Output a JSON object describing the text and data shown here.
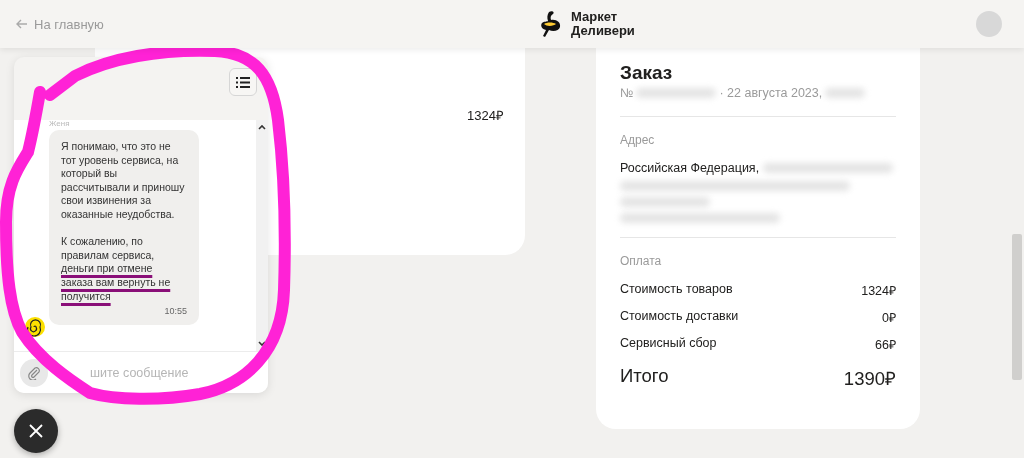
{
  "header": {
    "back_link": "На главную",
    "logo": {
      "line_1": "Маркет",
      "line_2": "Деливери"
    }
  },
  "items_card": {
    "price": "1324₽"
  },
  "chat": {
    "sender": "Женя",
    "messages": [
      {
        "paragraphs": [
          [
            {
              "text": "Я понимаю, что это не тот уровень сервиса, на который вы рассчитывали и приношу свои извинения за оказанные неудобства.",
              "underlined": false
            }
          ],
          [
            {
              "text": "К сожалению, по правилам сервиса, ",
              "underlined": false
            },
            {
              "text": "деньги при отмене заказа вам вернуть не получится",
              "underlined": true
            }
          ]
        ],
        "time": "10:55"
      }
    ],
    "input": {
      "placeholder": "шите сообщение"
    }
  },
  "order": {
    "title": "Заказ",
    "number_prefix": "№",
    "date": "· 22 августа 2023,",
    "address_label": "Адрес",
    "address": "Российская Федерация,",
    "payment_label": "Оплата",
    "lines": [
      {
        "label": "Стоимость товаров",
        "value": "1324₽"
      },
      {
        "label": "Стоимость доставки",
        "value": "0₽"
      },
      {
        "label": "Сервисный сбор",
        "value": "66₽"
      }
    ],
    "total": {
      "label": "Итого",
      "value": "1390₽"
    }
  }
}
